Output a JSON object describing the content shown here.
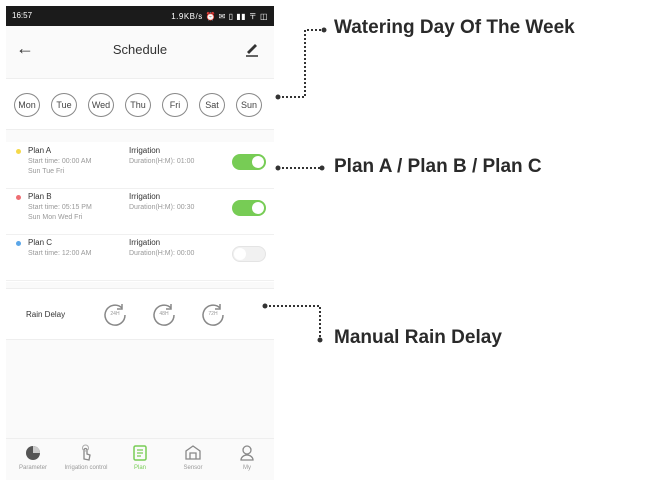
{
  "status": {
    "time": "16:57",
    "icons": "1.9KB/s ⏰ ✉ ▯ ▮▮ 〒 ◫"
  },
  "header": {
    "title": "Schedule"
  },
  "days": [
    "Mon",
    "Tue",
    "Wed",
    "Thu",
    "Fri",
    "Sat",
    "Sun"
  ],
  "plans": [
    {
      "name": "Plan A",
      "start": "Start time: 00:00 AM",
      "days": "Sun Tue Fri",
      "mode": "Irrigation",
      "duration": "Duration(H:M): 01:00",
      "enabled": true,
      "color": "#f5d94a"
    },
    {
      "name": "Plan B",
      "start": "Start time: 05:15 PM",
      "days": "Sun Mon Wed Fri",
      "mode": "Irrigation",
      "duration": "Duration(H:M): 00:30",
      "enabled": true,
      "color": "#ee6e73"
    },
    {
      "name": "Plan C",
      "start": "Start time: 12:00 AM",
      "days": "",
      "mode": "Irrigation",
      "duration": "Duration(H:M): 00:00",
      "enabled": false,
      "color": "#5aa6e8"
    }
  ],
  "rain_delay": {
    "label": "Rain Delay",
    "options": [
      "24H",
      "48H",
      "72H"
    ]
  },
  "nav": [
    {
      "label": "Parameter",
      "icon": "pie-chart-icon",
      "active": false
    },
    {
      "label": "Irrigation control",
      "icon": "tap-icon",
      "active": false
    },
    {
      "label": "Plan",
      "icon": "plan-icon",
      "active": true
    },
    {
      "label": "Sensor",
      "icon": "sensor-icon",
      "active": false
    },
    {
      "label": "My",
      "icon": "user-icon",
      "active": false
    }
  ],
  "annotations": {
    "days": "Watering Day Of The Week",
    "plans": "Plan A / Plan B / Plan C",
    "rain": "Manual Rain Delay"
  },
  "colors": {
    "accent": "#77cc55",
    "annotation_line": "#333333"
  }
}
